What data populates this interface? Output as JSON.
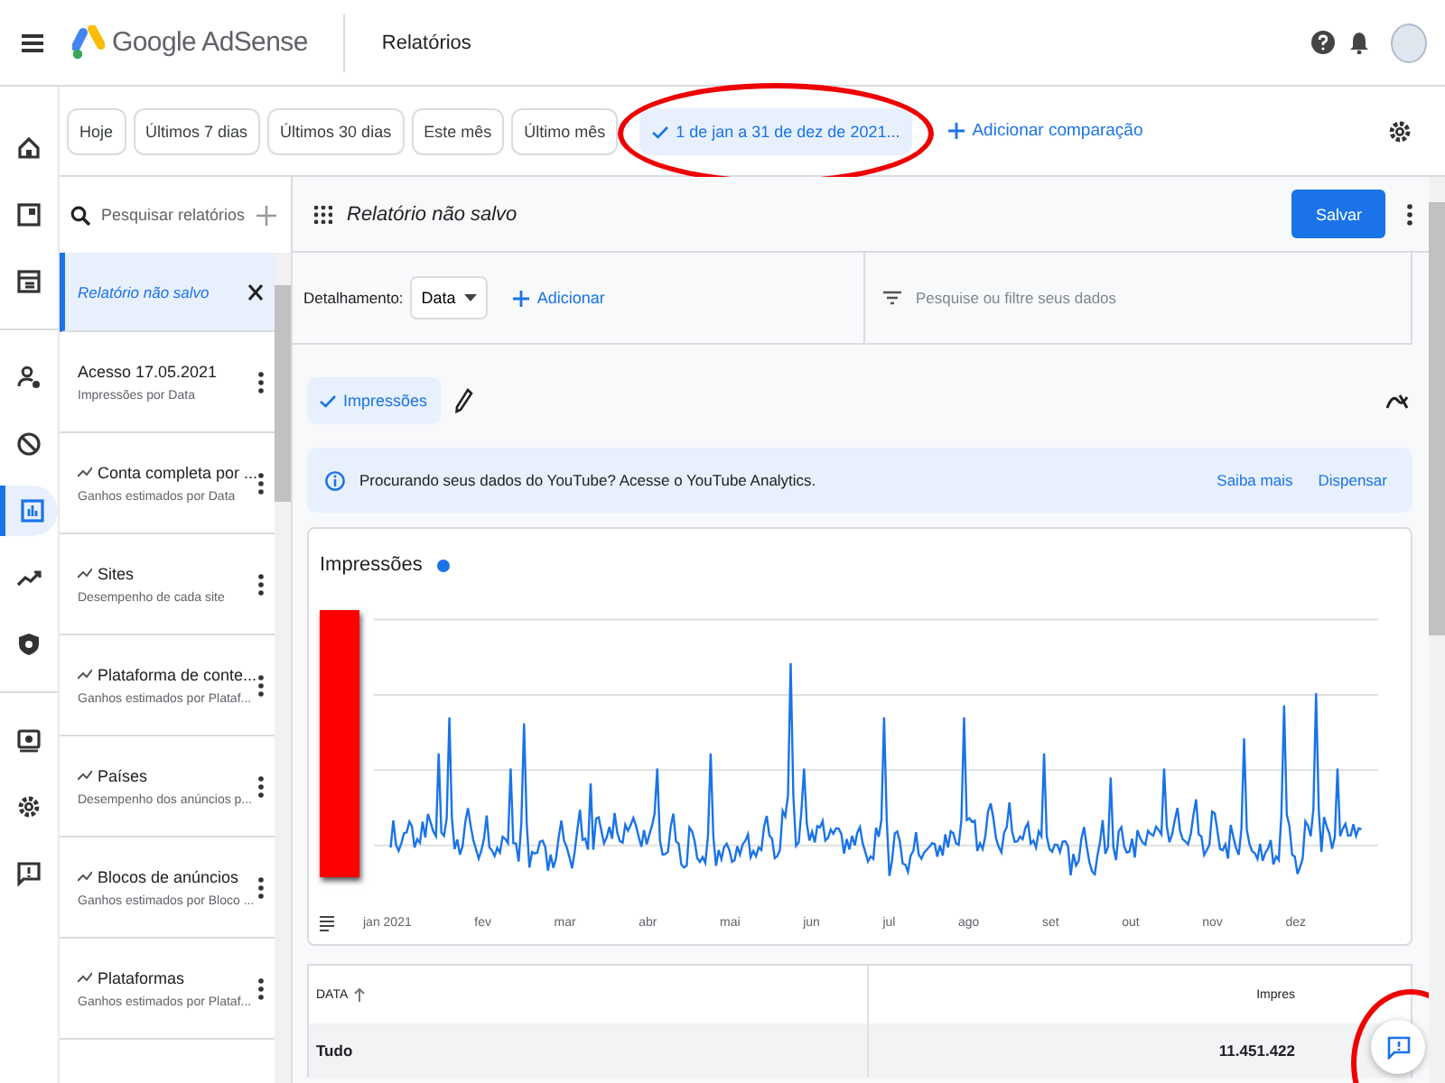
{
  "header": {
    "app_name": "Google AdSense",
    "page_title": "Relatórios"
  },
  "rail": [
    {
      "kind": "home",
      "selected": false
    },
    {
      "kind": "pages",
      "selected": false
    },
    {
      "kind": "ads",
      "selected": false
    },
    {
      "kind": "users",
      "selected": false
    },
    {
      "kind": "block",
      "selected": false
    },
    {
      "kind": "reports",
      "selected": true
    },
    {
      "kind": "trend",
      "selected": false
    },
    {
      "kind": "shield",
      "selected": false
    },
    {
      "kind": "payments",
      "selected": false
    },
    {
      "kind": "settings",
      "selected": false
    },
    {
      "kind": "feedback",
      "selected": false
    }
  ],
  "date_bar": {
    "chips": [
      {
        "label": "Hoje",
        "selected": false
      },
      {
        "label": "Últimos 7 dias",
        "selected": false
      },
      {
        "label": "Últimos 30 dias",
        "selected": false
      },
      {
        "label": "Este mês",
        "selected": false
      },
      {
        "label": "Último mês",
        "selected": false
      },
      {
        "label": "1 de jan a 31 de dez de 2021...",
        "selected": true
      }
    ],
    "add_comparison": "Adicionar comparação"
  },
  "sidebar": {
    "search_placeholder": "Pesquisar relatórios",
    "active_report": "Relatório não salvo",
    "reports": [
      {
        "kind": "saved",
        "title": "Acesso 17.05.2021",
        "subtitle": "Impressões por Data"
      },
      {
        "kind": "template",
        "title": "Conta completa por ...",
        "subtitle": "Ganhos estimados por Data"
      },
      {
        "kind": "template",
        "title": "Sites",
        "subtitle": "Desempenho de cada site"
      },
      {
        "kind": "template",
        "title": "Plataforma de conte...",
        "subtitle": "Ganhos estimados por Plataf..."
      },
      {
        "kind": "template",
        "title": "Países",
        "subtitle": "Desempenho dos anúncios p..."
      },
      {
        "kind": "template",
        "title": "Blocos de anúncios",
        "subtitle": "Ganhos estimados por Bloco ..."
      },
      {
        "kind": "template",
        "title": "Plataformas",
        "subtitle": "Ganhos estimados por Plataf..."
      }
    ]
  },
  "report": {
    "title": "Relatório não salvo",
    "save_button": "Salvar",
    "breakdown_label": "Detalhamento:",
    "breakdown_value": "Data",
    "add_label": "Adicionar",
    "filter_placeholder": "Pesquise ou filtre seus dados",
    "metric_chip": {
      "label": "Impressões",
      "selected": true
    },
    "banner": {
      "message": "Procurando seus dados do YouTube? Acesse o YouTube Analytics.",
      "links": [
        "Saiba mais",
        "Dispensar"
      ]
    },
    "chart": {
      "title": "Impressões",
      "x_labels": [
        "jan 2021",
        "fev",
        "mar",
        "abr",
        "mai",
        "jun",
        "jul",
        "ago",
        "set",
        "out",
        "nov",
        "dez"
      ]
    },
    "table": {
      "columns": [
        "DATA",
        "Impres"
      ],
      "rows": [
        {
          "cells": [
            "Tudo",
            "11.451.422"
          ]
        }
      ]
    }
  }
}
